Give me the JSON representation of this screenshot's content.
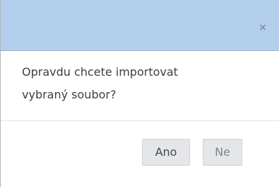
{
  "dialog": {
    "close_icon": "close-icon",
    "close_glyph": "×",
    "message_line1": "Opravdu chcete importovat",
    "message_line2": "vybraný soubor?",
    "buttons": {
      "ano_label": "Ano",
      "ne_label": "Ne"
    }
  },
  "colors": {
    "titlebar": "#b4cfeb",
    "button_bg": "#e4e6e9",
    "text": "#3b3f44"
  }
}
